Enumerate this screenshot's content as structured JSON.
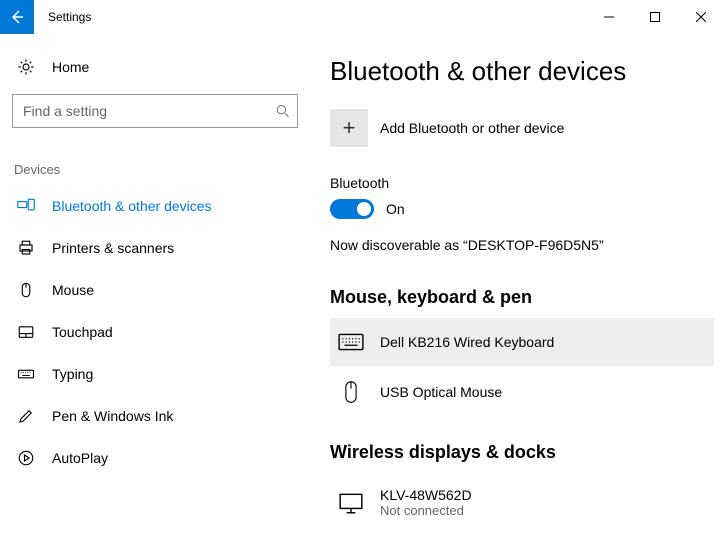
{
  "window": {
    "title": "Settings"
  },
  "sidebar": {
    "home_label": "Home",
    "search_placeholder": "Find a setting",
    "category_label": "Devices",
    "items": [
      {
        "label": "Bluetooth & other devices"
      },
      {
        "label": "Printers & scanners"
      },
      {
        "label": "Mouse"
      },
      {
        "label": "Touchpad"
      },
      {
        "label": "Typing"
      },
      {
        "label": "Pen & Windows Ink"
      },
      {
        "label": "AutoPlay"
      }
    ]
  },
  "main": {
    "title": "Bluetooth & other devices",
    "add_device_label": "Add Bluetooth or other device",
    "bluetooth_label": "Bluetooth",
    "toggle_state": "On",
    "discoverable_text": "Now discoverable as “DESKTOP-F96D5N5”",
    "mouse_keyboard_heading": "Mouse, keyboard & pen",
    "devices": [
      {
        "name": "Dell KB216 Wired Keyboard"
      },
      {
        "name": "USB Optical Mouse"
      }
    ],
    "wireless_heading": "Wireless displays & docks",
    "wireless_devices": [
      {
        "name": "KLV-48W562D",
        "status": "Not connected"
      }
    ]
  }
}
